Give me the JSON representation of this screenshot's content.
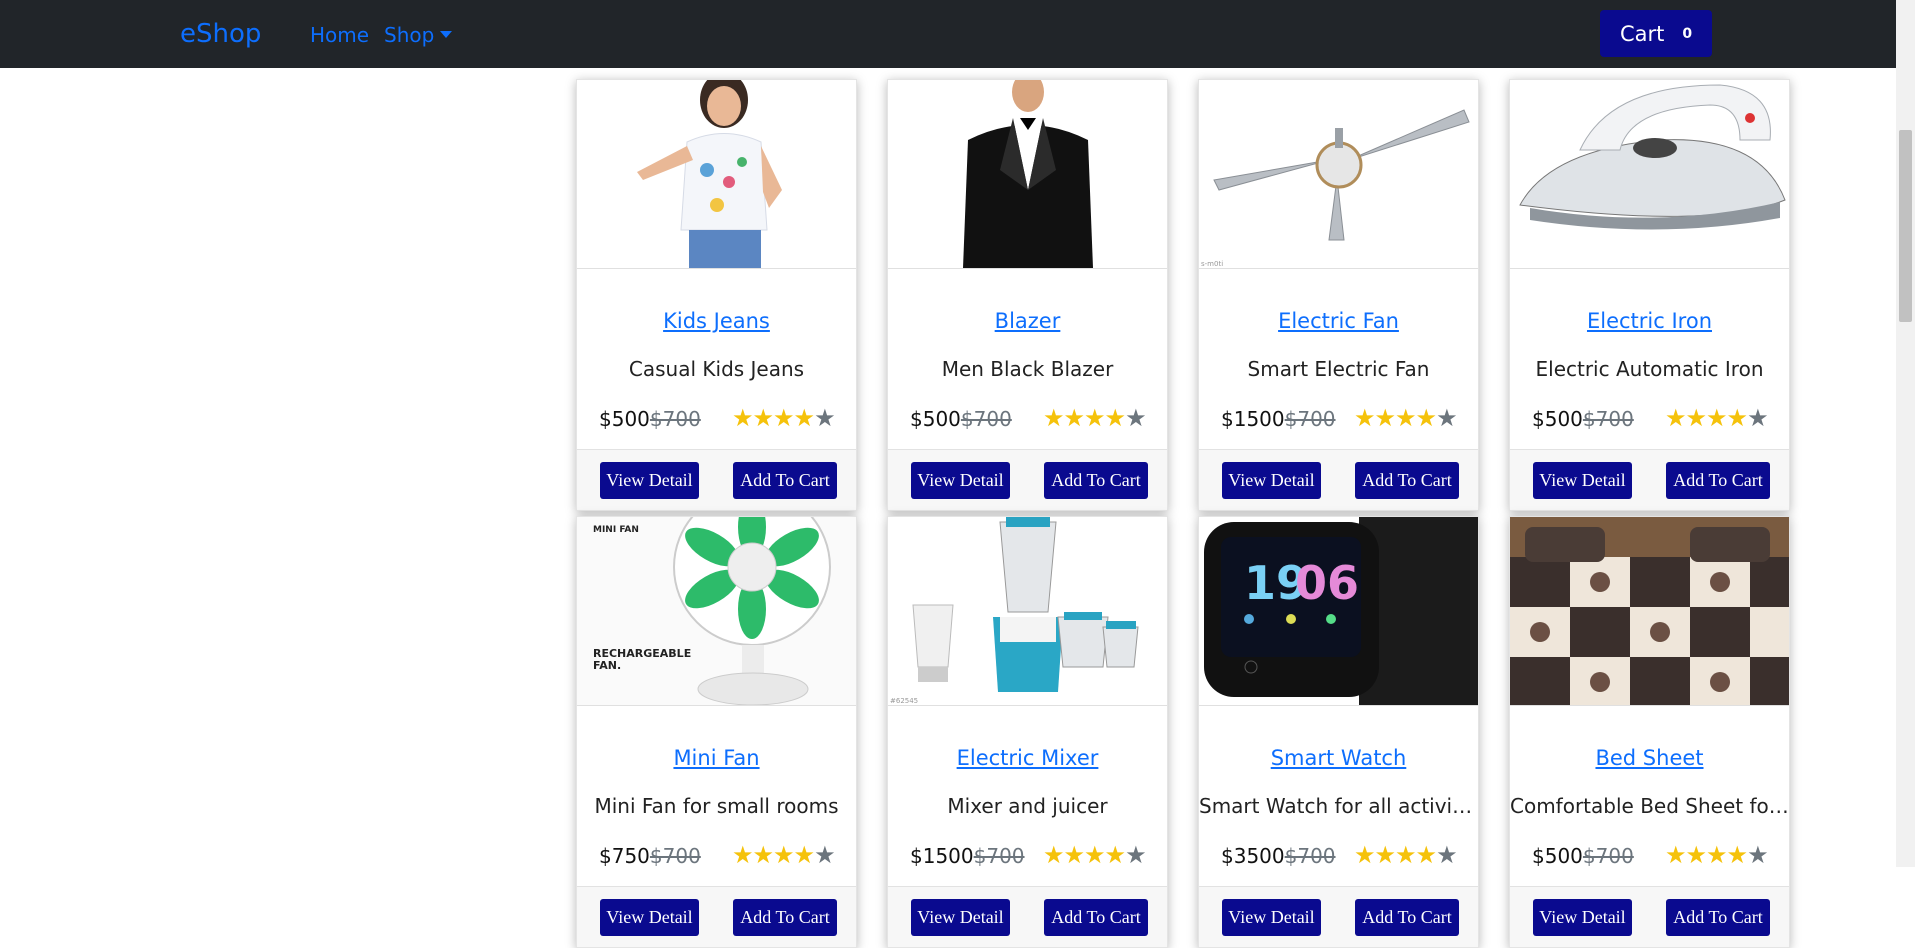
{
  "nav": {
    "brand": "eShop",
    "home": "Home",
    "shop": "Shop",
    "cart_label": "Cart",
    "cart_count": "0"
  },
  "products": [
    {
      "title": "Kids Jeans",
      "description": "Casual Kids Jeans",
      "price": "$500",
      "old_price": "$700",
      "rating": 4,
      "max_rating": 5,
      "image": "girl-in-tshirt-photo"
    },
    {
      "title": "Blazer",
      "description": "Men Black Blazer",
      "price": "$500",
      "old_price": "$700",
      "rating": 4,
      "max_rating": 5,
      "image": "man-in-tuxedo-photo"
    },
    {
      "title": "Electric Fan",
      "description": "Smart Electric Fan",
      "price": "$1500",
      "old_price": "$700",
      "rating": 4,
      "max_rating": 5,
      "image": "ceiling-fan-photo"
    },
    {
      "title": "Electric Iron",
      "description": "Electric Automatic Iron",
      "price": "$500",
      "old_price": "$700",
      "rating": 4,
      "max_rating": 5,
      "image": "electric-iron-photo"
    },
    {
      "title": "Mini Fan",
      "description": "Mini Fan for small rooms",
      "price": "$750",
      "old_price": "$700",
      "rating": 4,
      "max_rating": 5,
      "image": "mini-fan-photo",
      "image_text": [
        "MINI FAN",
        "RECHARGEABLE",
        "FAN."
      ]
    },
    {
      "title": "Electric Mixer",
      "description": "Mixer and juicer",
      "price": "$1500",
      "old_price": "$700",
      "rating": 4,
      "max_rating": 5,
      "image": "mixer-grinder-photo"
    },
    {
      "title": "Smart Watch",
      "description": "Smart Watch for all activities",
      "price": "$3500",
      "old_price": "$700",
      "rating": 4,
      "max_rating": 5,
      "image": "smart-watch-photo",
      "image_text": [
        "19:06"
      ]
    },
    {
      "title": "Bed Sheet",
      "description": "Comfortable Bed Sheet for home",
      "price": "$500",
      "old_price": "$700",
      "rating": 4,
      "max_rating": 5,
      "image": "bed-sheet-photo"
    }
  ],
  "buttons": {
    "view_detail": "View Detail",
    "add_to_cart": "Add To Cart"
  },
  "colors": {
    "navbar_bg": "#212529",
    "link": "#0d6efd",
    "button_bg": "#0a0a8f",
    "star_on": "#f5c20b",
    "star_off": "#6c757d"
  }
}
